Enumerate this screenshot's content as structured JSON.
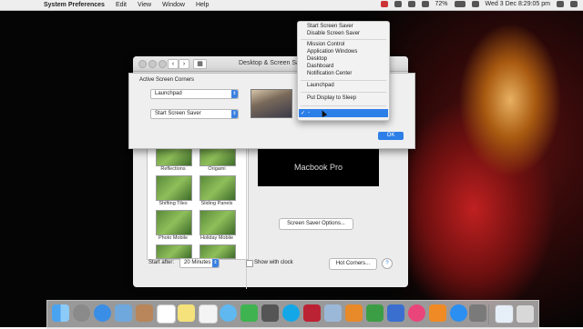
{
  "menubar": {
    "app_name": "System Preferences",
    "menus": [
      "Edit",
      "View",
      "Window",
      "Help"
    ],
    "battery": "72%",
    "clock": "Wed 3 Dec  8:29:05 pm"
  },
  "window": {
    "title": "Desktop & Screen Saver",
    "savers": [
      {
        "label": "Reflections"
      },
      {
        "label": "Origami"
      },
      {
        "label": "Shifting Tiles"
      },
      {
        "label": "Sliding Panels"
      },
      {
        "label": "Photo Mobile"
      },
      {
        "label": "Holiday Mobile"
      }
    ],
    "preview_text": "Macbook Pro",
    "options_button": "Screen Saver Options...",
    "start_after_label": "Start after:",
    "start_after_value": "20 Minutes",
    "show_clock_label": "Show with clock",
    "hot_corners_button": "Hot Corners...",
    "help_icon": "?"
  },
  "sheet": {
    "title": "Active Screen Corners",
    "top_left": "Launchpad",
    "bottom_left": "Start Screen Saver",
    "ok_button": "OK"
  },
  "corner_menu": {
    "groups": [
      [
        "Start Screen Saver",
        "Disable Screen Saver"
      ],
      [
        "Mission Control",
        "Application Windows",
        "Desktop",
        "Dashboard",
        "Notification Center"
      ],
      [
        "Launchpad"
      ],
      [
        "Put Display to Sleep"
      ]
    ],
    "selected": "-",
    "checkmark": "✓"
  },
  "colors": {
    "accent": "#2d7fe8",
    "menu_bg": "#f2f2f2"
  },
  "dock": {
    "icons": [
      "finder-icon",
      "launchpad-icon",
      "safari-icon",
      "mail-icon",
      "contacts-icon",
      "calendar-icon",
      "notes-icon",
      "reminders-icon",
      "messages-icon",
      "facetime-icon",
      "photo-booth-icon",
      "skype-icon",
      "photo-icon",
      "preview-icon",
      "pages-icon",
      "numbers-icon",
      "keynote-icon",
      "itunes-icon",
      "ibooks-icon",
      "app-store-icon",
      "system-preferences-icon",
      "document-icon",
      "trash-icon"
    ]
  }
}
